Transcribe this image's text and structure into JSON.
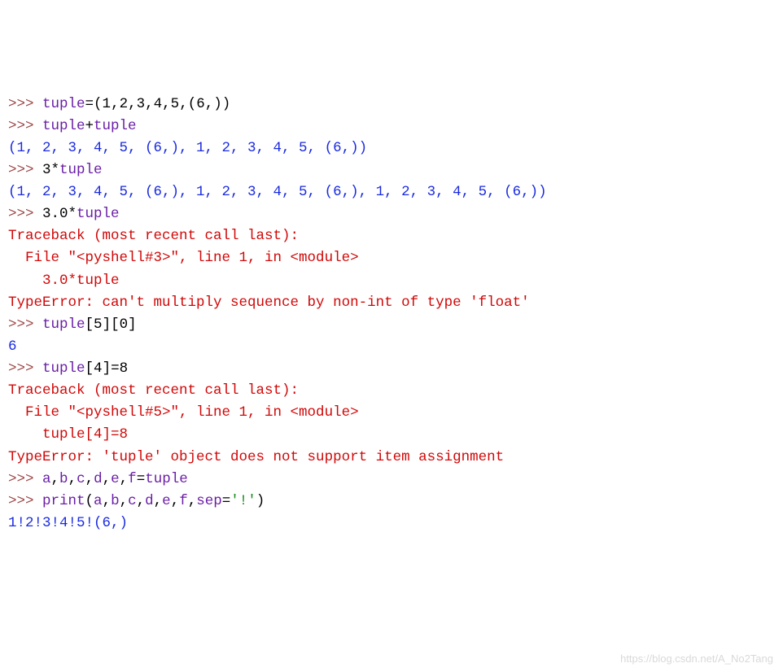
{
  "prompt": ">>> ",
  "lines": [
    {
      "t": "in",
      "segments": [
        {
          "c": "ident",
          "v": "tuple"
        },
        {
          "c": "punct",
          "v": "=("
        },
        {
          "c": "num",
          "v": "1"
        },
        {
          "c": "punct",
          "v": ","
        },
        {
          "c": "num",
          "v": "2"
        },
        {
          "c": "punct",
          "v": ","
        },
        {
          "c": "num",
          "v": "3"
        },
        {
          "c": "punct",
          "v": ","
        },
        {
          "c": "num",
          "v": "4"
        },
        {
          "c": "punct",
          "v": ","
        },
        {
          "c": "num",
          "v": "5"
        },
        {
          "c": "punct",
          "v": ",("
        },
        {
          "c": "num",
          "v": "6"
        },
        {
          "c": "punct",
          "v": ",))"
        }
      ]
    },
    {
      "t": "in",
      "segments": [
        {
          "c": "ident",
          "v": "tuple"
        },
        {
          "c": "punct",
          "v": "+"
        },
        {
          "c": "ident",
          "v": "tuple"
        }
      ]
    },
    {
      "t": "out",
      "text": "(1, 2, 3, 4, 5, (6,), 1, 2, 3, 4, 5, (6,))"
    },
    {
      "t": "in",
      "segments": [
        {
          "c": "num",
          "v": "3"
        },
        {
          "c": "punct",
          "v": "*"
        },
        {
          "c": "ident",
          "v": "tuple"
        }
      ]
    },
    {
      "t": "out",
      "text": "(1, 2, 3, 4, 5, (6,), 1, 2, 3, 4, 5, (6,), 1, 2, 3, 4, 5, (6,))"
    },
    {
      "t": "in",
      "segments": [
        {
          "c": "num",
          "v": "3.0"
        },
        {
          "c": "punct",
          "v": "*"
        },
        {
          "c": "ident",
          "v": "tuple"
        }
      ]
    },
    {
      "t": "err",
      "text": "Traceback (most recent call last):"
    },
    {
      "t": "err",
      "text": "  File \"<pyshell#3>\", line 1, in <module>"
    },
    {
      "t": "err",
      "text": "    3.0*tuple"
    },
    {
      "t": "err",
      "text": "TypeError: can't multiply sequence by non-int of type 'float'"
    },
    {
      "t": "in",
      "segments": [
        {
          "c": "ident",
          "v": "tuple"
        },
        {
          "c": "punct",
          "v": "["
        },
        {
          "c": "num",
          "v": "5"
        },
        {
          "c": "punct",
          "v": "]["
        },
        {
          "c": "num",
          "v": "0"
        },
        {
          "c": "punct",
          "v": "]"
        }
      ]
    },
    {
      "t": "out",
      "text": "6"
    },
    {
      "t": "in",
      "segments": [
        {
          "c": "ident",
          "v": "tuple"
        },
        {
          "c": "punct",
          "v": "["
        },
        {
          "c": "num",
          "v": "4"
        },
        {
          "c": "punct",
          "v": "]="
        },
        {
          "c": "num",
          "v": "8"
        }
      ]
    },
    {
      "t": "err",
      "text": "Traceback (most recent call last):"
    },
    {
      "t": "err",
      "text": "  File \"<pyshell#5>\", line 1, in <module>"
    },
    {
      "t": "err",
      "text": "    tuple[4]=8"
    },
    {
      "t": "err",
      "text": "TypeError: 'tuple' object does not support item assignment"
    },
    {
      "t": "in",
      "segments": [
        {
          "c": "ident",
          "v": "a"
        },
        {
          "c": "punct",
          "v": ","
        },
        {
          "c": "ident",
          "v": "b"
        },
        {
          "c": "punct",
          "v": ","
        },
        {
          "c": "ident",
          "v": "c"
        },
        {
          "c": "punct",
          "v": ","
        },
        {
          "c": "ident",
          "v": "d"
        },
        {
          "c": "punct",
          "v": ","
        },
        {
          "c": "ident",
          "v": "e"
        },
        {
          "c": "punct",
          "v": ","
        },
        {
          "c": "ident",
          "v": "f"
        },
        {
          "c": "punct",
          "v": "="
        },
        {
          "c": "ident",
          "v": "tuple"
        }
      ]
    },
    {
      "t": "in",
      "segments": [
        {
          "c": "builtin",
          "v": "print"
        },
        {
          "c": "punct",
          "v": "("
        },
        {
          "c": "ident",
          "v": "a"
        },
        {
          "c": "punct",
          "v": ","
        },
        {
          "c": "ident",
          "v": "b"
        },
        {
          "c": "punct",
          "v": ","
        },
        {
          "c": "ident",
          "v": "c"
        },
        {
          "c": "punct",
          "v": ","
        },
        {
          "c": "ident",
          "v": "d"
        },
        {
          "c": "punct",
          "v": ","
        },
        {
          "c": "ident",
          "v": "e"
        },
        {
          "c": "punct",
          "v": ","
        },
        {
          "c": "ident",
          "v": "f"
        },
        {
          "c": "punct",
          "v": ","
        },
        {
          "c": "ident",
          "v": "sep"
        },
        {
          "c": "punct",
          "v": "="
        },
        {
          "c": "str",
          "v": "'!'"
        },
        {
          "c": "punct",
          "v": ")"
        }
      ]
    },
    {
      "t": "out",
      "text": "1!2!3!4!5!(6,)"
    }
  ],
  "watermark": "https://blog.csdn.net/A_No2Tang"
}
